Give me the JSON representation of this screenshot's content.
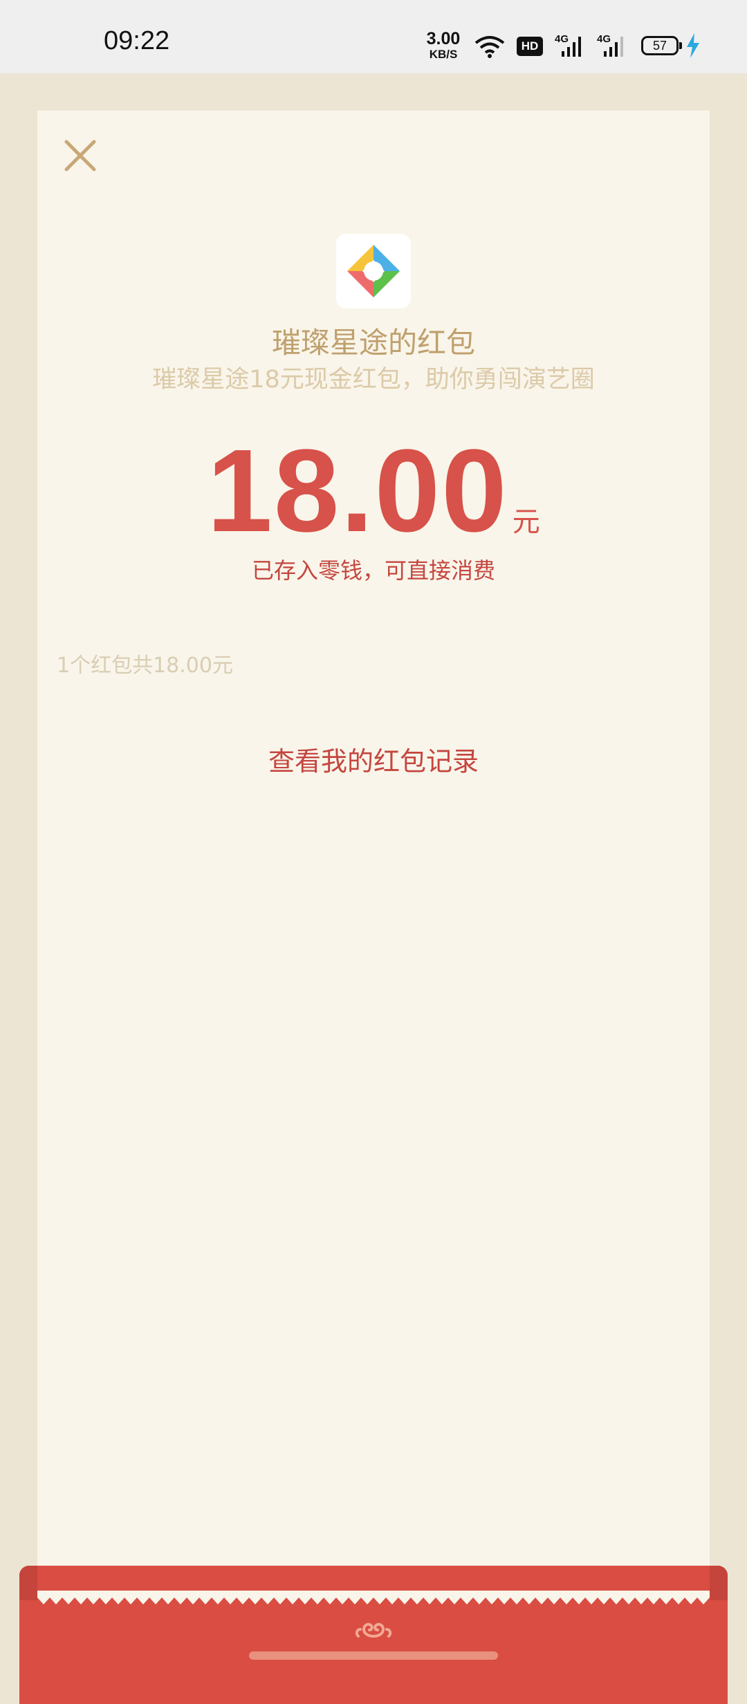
{
  "status_bar": {
    "time": "09:22",
    "net_speed_value": "3.00",
    "net_speed_unit": "KB/S",
    "hd_label": "HD",
    "network_1": "4G",
    "network_2": "4G",
    "battery": "57"
  },
  "packet": {
    "sender": "璀璨星途的红包",
    "message": "璀璨星途18元现金红包，助你勇闯演艺圈",
    "amount": "18.00",
    "unit": "元",
    "saved_note": "已存入零钱，可直接消费",
    "summary": "1个红包共18.00元",
    "records_link": "查看我的红包记录"
  },
  "colors": {
    "accent_red": "#d7524a",
    "gold_text": "#bfa06e",
    "card_bg": "#f9f5ea",
    "envelope_red": "#d94d42"
  },
  "icons": {
    "close": "close-icon",
    "app": "app-logo-icon",
    "cloud": "auspicious-cloud-icon"
  }
}
